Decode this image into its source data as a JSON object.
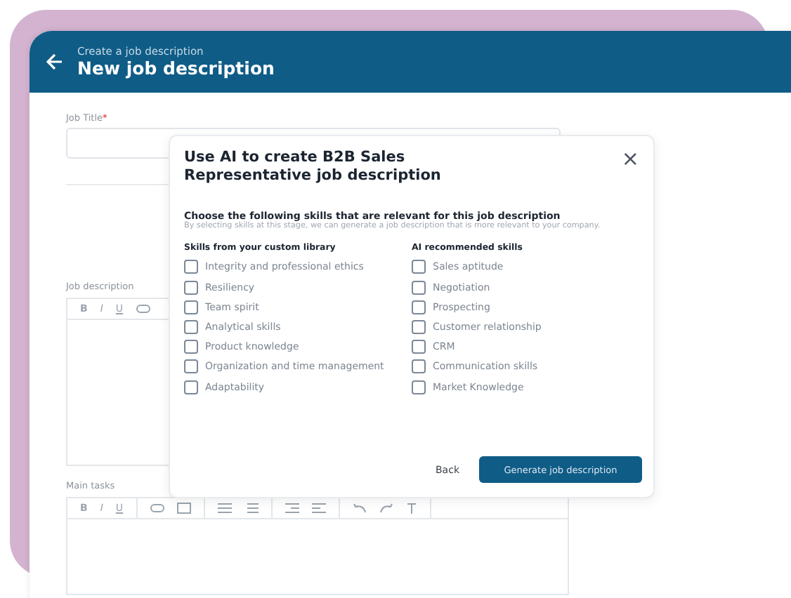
{
  "header": {
    "subtitle": "Create a job description",
    "title": "New job description"
  },
  "form": {
    "job_title": {
      "label": "Job Title",
      "required_mark": "*"
    },
    "job_description": {
      "label": "Job description",
      "toolbar": [
        "B",
        "I",
        "U"
      ]
    },
    "main_tasks": {
      "label": "Main tasks",
      "toolbar": [
        "B",
        "I",
        "U"
      ]
    }
  },
  "dialog": {
    "title": "Use AI to create B2B Sales Representative job description",
    "close": "×",
    "heading": "Choose the following skills that are relevant for this job description",
    "hint": "By selecting skills at this stage, we can generate a job description that is more relevant to your company.",
    "columns": [
      {
        "title": "Skills from your custom library",
        "skills": [
          {
            "label": "Integrity and professional ethics",
            "checked": false
          },
          {
            "label": "Resiliency",
            "checked": false
          },
          {
            "label": "Team spirit",
            "checked": false
          },
          {
            "label": "Analytical skills",
            "checked": false
          },
          {
            "label": "Product knowledge",
            "checked": false
          },
          {
            "label": "Organization and time management",
            "checked": false
          },
          {
            "label": "Adaptability",
            "checked": false
          }
        ]
      },
      {
        "title": "AI recommended skills",
        "skills": [
          {
            "label": "Sales aptitude",
            "checked": false
          },
          {
            "label": "Negotiation",
            "checked": false
          },
          {
            "label": "Prospecting",
            "checked": false
          },
          {
            "label": "Customer relationship",
            "checked": false
          },
          {
            "label": "CRM",
            "checked": false
          },
          {
            "label": "Communication skills",
            "checked": false
          },
          {
            "label": "Market Knowledge",
            "checked": false
          }
        ]
      }
    ],
    "buttons": [
      "Back",
      "Generate job description"
    ]
  }
}
